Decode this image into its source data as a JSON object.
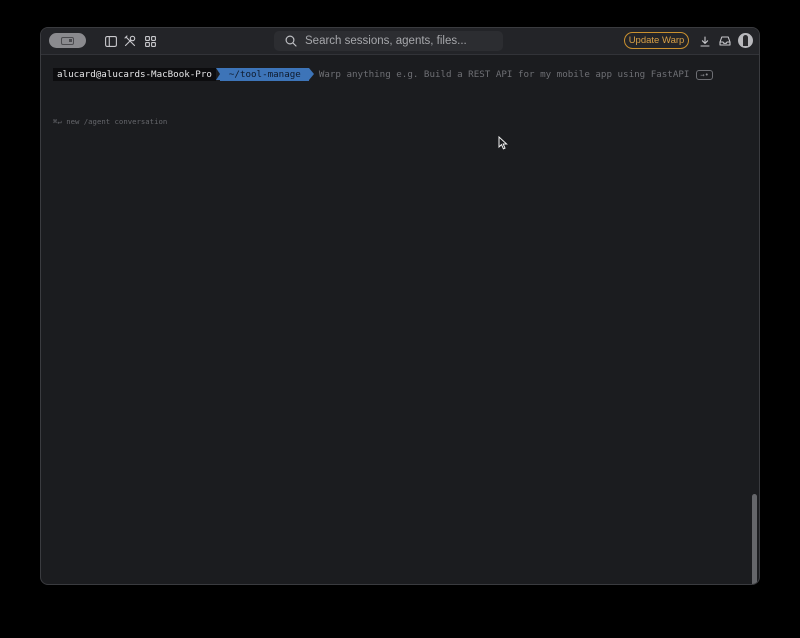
{
  "titlebar": {
    "toggle_icon": "panel-toggle-icon",
    "sidebar_icon": "sidebar-icon",
    "tools_icon": "tools-icon",
    "grid_icon": "grid-icon",
    "search_placeholder": "Search sessions, agents, files...",
    "update_label": "Update Warp",
    "download_icon": "download-icon",
    "inbox_icon": "inbox-icon",
    "avatar_icon": "avatar-icon",
    "accent_color": "#c9902f"
  },
  "terminal": {
    "user_host": "alucard@alucards-MacBook-Pro",
    "directory": "~/tool-manage",
    "input_placeholder": "Warp anything e.g. Build a REST API for my mobile app using FastAPI",
    "submit_shortcut": "→•",
    "hint_shortcut": "⌘↵",
    "hint_text": "new /agent conversation",
    "directory_color": "#3d74b8"
  }
}
